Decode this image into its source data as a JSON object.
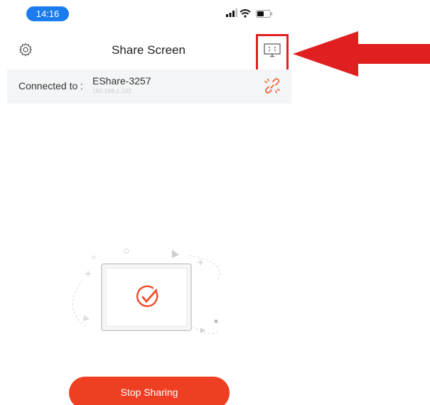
{
  "status_bar": {
    "time": "14:16"
  },
  "header": {
    "title": "Share Screen"
  },
  "connection": {
    "label": "Connected to :",
    "device_name": "EShare-3257",
    "ip": "192.168.1.102"
  },
  "actions": {
    "stop_label": "Stop Sharing"
  },
  "colors": {
    "accent": "#ee3f23",
    "time_pill": "#1b7cf0",
    "annotation": "#e02020",
    "row_bg": "#f4f5f6"
  },
  "icons": [
    "settings-gear-icon",
    "screen-mirror-icon",
    "unlink-icon",
    "checkmark-icon"
  ]
}
